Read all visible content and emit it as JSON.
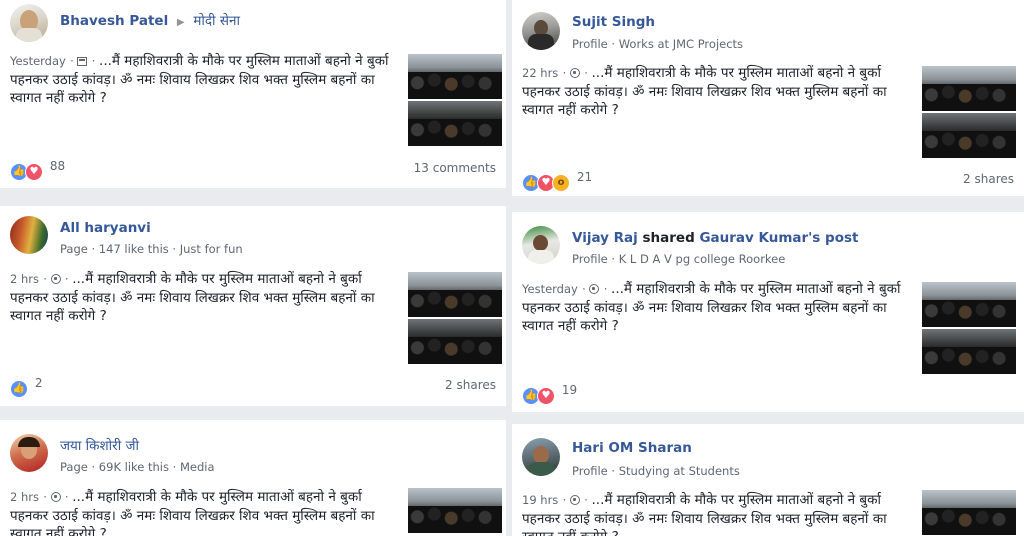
{
  "post_text": {
    "prefix": "...मैं महाशिवरात्री के मौके पर मुस्लिम माताओं बहनो ने बुर्का पहनकर उठाई कांवड़। ॐ नमः शिवाय लिखक्रर शिव भक्त मुस्लिम बहनों का स्वागत नहीं करोगे ?"
  },
  "posts": [
    {
      "author": "Bhavesh Patel",
      "group": "मोदी सेना",
      "time": "Yesterday",
      "reaction_count": "88",
      "right_meta": "13 comments"
    },
    {
      "author": "Sujit Singh",
      "sub": "Profile · Works at JMC Projects",
      "time": "22 hrs",
      "reaction_count": "21",
      "right_meta": "2 shares"
    },
    {
      "author": "All haryanvi",
      "sub": "Page · 147 like this · Just for fun",
      "time": "2 hrs",
      "reaction_count": "2",
      "right_meta": "2 shares"
    },
    {
      "author": "Vijay Raj",
      "shared_word": "shared",
      "shared_target": "Gaurav Kumar's post",
      "sub": "Profile · K L D A V pg college Roorkee",
      "time": "Yesterday",
      "reaction_count": "19",
      "right_meta": ""
    },
    {
      "author": "जया किशोरी जी",
      "sub": "Page · 69K like this · Media",
      "time": "2 hrs",
      "reaction_count": "",
      "right_meta": ""
    },
    {
      "author": "Hari OM Sharan",
      "sub": "Profile · Studying at Students",
      "time": "19 hrs",
      "reaction_count": "",
      "right_meta": ""
    }
  ],
  "colors": {
    "background": "#e9ebee",
    "name_link": "#365899",
    "like_blue": "#5890ff",
    "love_red": "#f25268"
  },
  "icons": [
    "calendar-icon",
    "globe-icon",
    "like-reaction-icon",
    "love-reaction-icon",
    "wow-reaction-icon"
  ]
}
